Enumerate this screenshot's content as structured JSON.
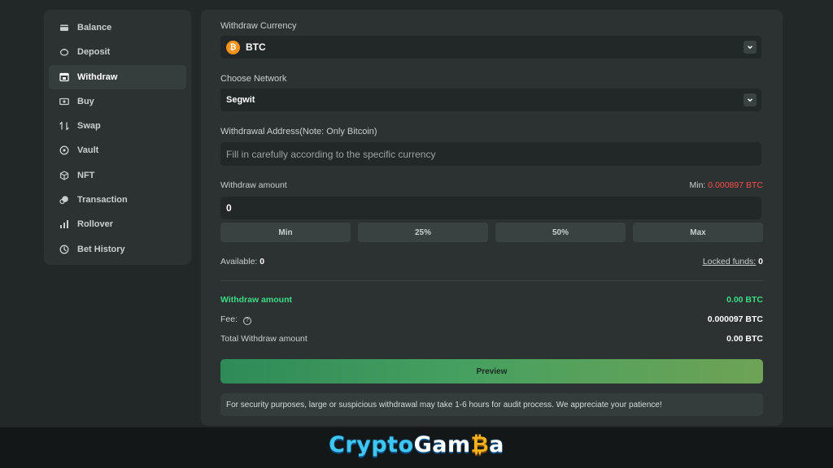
{
  "sidebar": {
    "items": [
      {
        "label": "Balance",
        "icon": "wallet-icon",
        "active": false
      },
      {
        "label": "Deposit",
        "icon": "piggy-bank-icon",
        "active": false
      },
      {
        "label": "Withdraw",
        "icon": "withdraw-icon",
        "active": true
      },
      {
        "label": "Buy",
        "icon": "cash-icon",
        "active": false
      },
      {
        "label": "Swap",
        "icon": "swap-icon",
        "active": false
      },
      {
        "label": "Vault",
        "icon": "vault-icon",
        "active": false
      },
      {
        "label": "NFT",
        "icon": "cube-icon",
        "active": false
      },
      {
        "label": "Transaction",
        "icon": "transaction-icon",
        "active": false
      },
      {
        "label": "Rollover",
        "icon": "bar-chart-icon",
        "active": false
      },
      {
        "label": "Bet History",
        "icon": "clock-icon",
        "active": false
      }
    ]
  },
  "withdraw": {
    "currency_label": "Withdraw Currency",
    "currency_value": "BTC",
    "currency_symbol": "₿",
    "network_label": "Choose Network",
    "network_value": "Segwit",
    "address_label": "Withdrawal Address(Note: Only Bitcoin)",
    "address_placeholder": "Fill in carefully according to the specific currency",
    "amount_label": "Withdraw amount",
    "min_label": "Min:",
    "min_value": "0.000897 BTC",
    "amount_value": "0",
    "quick_buttons": [
      "Min",
      "25%",
      "50%",
      "Max"
    ],
    "available_label": "Available:",
    "available_value": "0",
    "locked_label": "Locked funds:",
    "locked_value": "0"
  },
  "summary": {
    "withdraw_amount_label": "Withdraw amount",
    "withdraw_amount_value": "0.00 BTC",
    "fee_label": "Fee:",
    "fee_value": "0.000097 BTC",
    "total_label": "Total Withdraw amount",
    "total_value": "0.00 BTC"
  },
  "preview_label": "Preview",
  "notice": "For security purposes, large or suspicious withdrawal may take 1-6 hours for audit process. We appreciate your patience!",
  "brand": {
    "part1": "Crypto",
    "part2": "Gam",
    "coin": "₿",
    "part3": "a"
  },
  "colors": {
    "accent_green": "#3ddc84",
    "min_red": "#ff4d4d",
    "btc_orange": "#f7931a"
  }
}
